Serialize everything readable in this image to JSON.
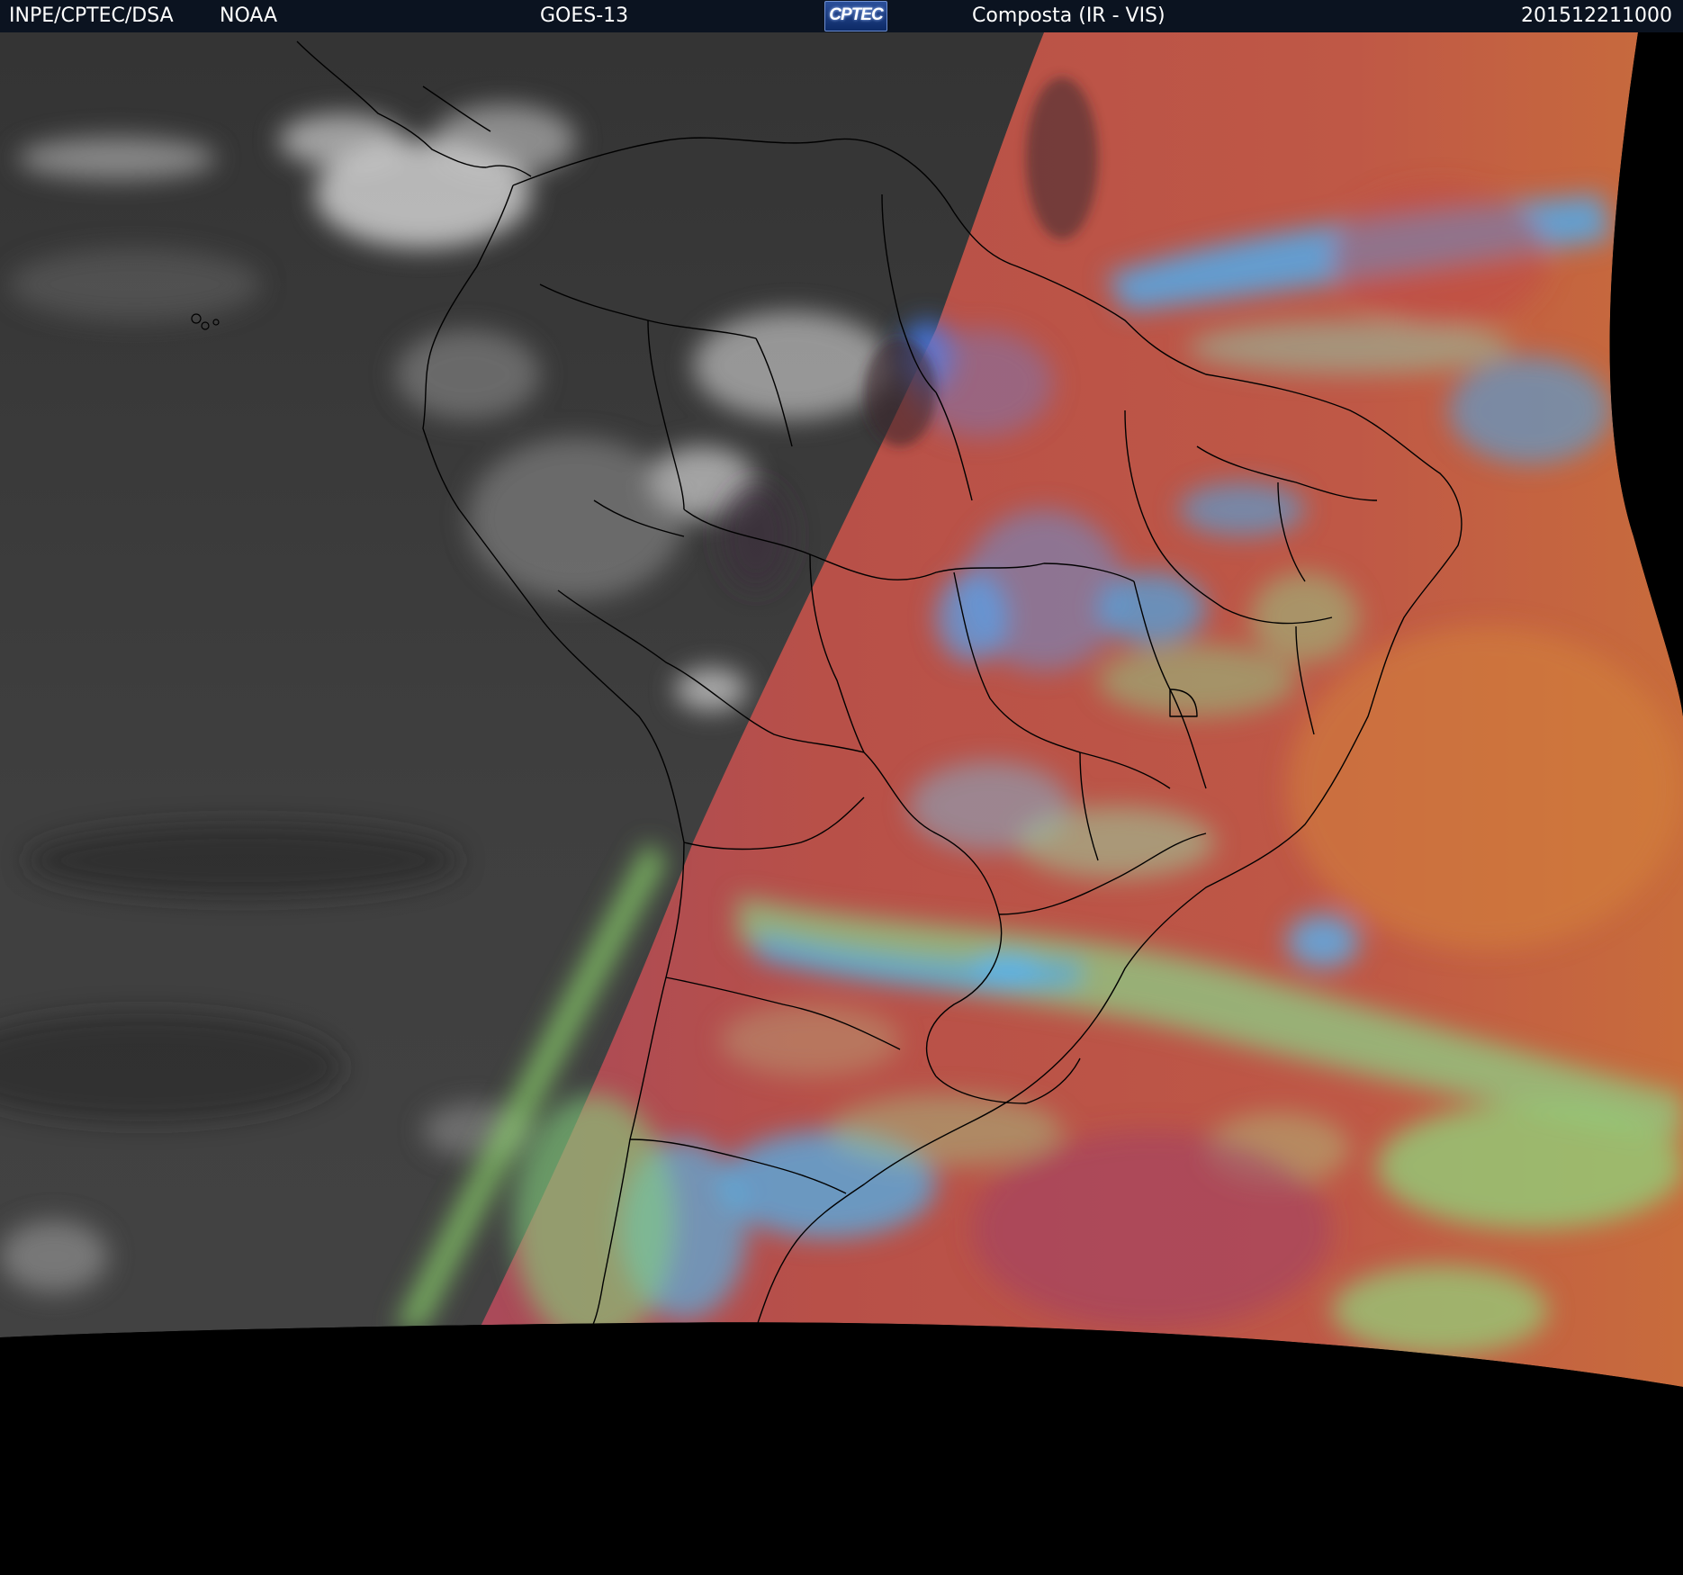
{
  "header": {
    "agency": "INPE/CPTEC/DSA",
    "partner": "NOAA",
    "satellite": "GOES-13",
    "logo_text": "CPTEC",
    "product": "Composta (IR - VIS)",
    "timestamp": "201512211000"
  },
  "image": {
    "view": "satellite composite",
    "night_side": "infrared grayscale",
    "day_side": "false color visible",
    "colors": {
      "header_background": "#0b1320",
      "night_ocean": "#3d3d3d",
      "day_surface": "#b8504a",
      "high_cloud": "#4aa8e8",
      "low_cloud": "#8ee07a",
      "outline": "#000000"
    }
  }
}
